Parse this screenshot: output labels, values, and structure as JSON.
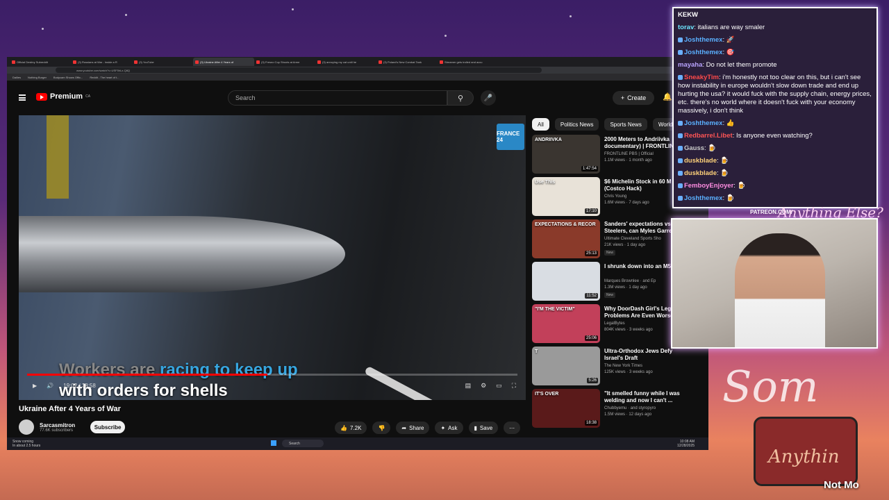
{
  "browser": {
    "tabs": [
      {
        "label": "Official Destiny Subreddit",
        "active": false
      },
      {
        "label": "(3) Russians at War - Inside a R",
        "active": false
      },
      {
        "label": "(3) YouTube",
        "active": false
      },
      {
        "label": "(3) Ukraine After 4 Years of",
        "active": true
      },
      {
        "label": "(3) Fresno Cop Shoots at Arme",
        "active": false
      },
      {
        "label": "(3) annoying my cat until he",
        "active": false
      },
      {
        "label": "(3) Poland's New Combat Tank",
        "active": false
      },
      {
        "label": "Streamer gets trolled and accu",
        "active": false
      }
    ],
    "url": "www.youtube.com/watch?v=USF5hLz-Q8Q",
    "bookmarks": [
      "Dailies",
      "Nothing Burger",
      "Bodycam Shows Offic...",
      "Reddit - The heart of t..."
    ]
  },
  "youtube": {
    "logo": "Premium",
    "logo_region": "CA",
    "search_placeholder": "Search",
    "create_label": "Create",
    "player": {
      "subtitle_dim": "Workers are",
      "subtitle_hl1": "racing to",
      "subtitle_hl2": "keep up",
      "subtitle_line2": "with orders for shells",
      "time": "19:02 / 38:58",
      "progress_fraction": 0.49,
      "channel_logo": "FRANCE 24"
    },
    "video": {
      "title": "Ukraine After 4 Years of War",
      "channel": "Sarcasmitron",
      "subscribers": "77.6K subscribers",
      "subscribe_label": "Subscribe",
      "likes": "7.2K",
      "share_label": "Share",
      "ask_label": "Ask",
      "save_label": "Save"
    },
    "chips": [
      "All",
      "Politics News",
      "Sports News",
      "World N"
    ],
    "recommendations": [
      {
        "title": "2000 Meters to Andriivka documentary) | FRONTLIN",
        "channel": "FRONTLINE PBS | Official",
        "meta": "1.1M views · 1 month ago",
        "duration": "1:47:54",
        "badge": "",
        "thumb_label": "ANDRIIVKA",
        "thumb_color": "#3a3530"
      },
      {
        "title": "$6 Michelin Stock in 60 M (Costco Hack)",
        "channel": "Chris Young",
        "meta": "1.6M views · 7 days ago",
        "duration": "17:10",
        "badge": "",
        "thumb_label": "Use This",
        "thumb_color": "#e8e2d8"
      },
      {
        "title": "Sanders' expectations vs Steelers, can Myles Garre",
        "channel": "Ultimate Cleveland Sports Sho",
        "meta": "21K views · 1 day ago",
        "duration": "25:13",
        "badge": "New",
        "thumb_label": "EXPECTATIONS & RECOR",
        "thumb_color": "#8a3a2a"
      },
      {
        "title": "I shrunk down into an M5",
        "channel": "Marques Brownlee · and Ep",
        "meta": "1.3M views · 1 day ago",
        "duration": "11:52",
        "badge": "New",
        "thumb_label": "",
        "thumb_color": "#d9dde3"
      },
      {
        "title": "Why DoorDash Girl's Lega Problems Are Even Worse",
        "channel": "LegalBytes",
        "meta": "804K views · 3 weeks ago",
        "duration": "25:06",
        "badge": "",
        "thumb_label": "\"I'M THE VICTIM\"",
        "thumb_color": "#c2405a"
      },
      {
        "title": "Ultra-Orthodox Jews Defy Israel's Draft",
        "channel": "The New York Times",
        "meta": "125K views · 3 weeks ago",
        "duration": "5:26",
        "badge": "",
        "thumb_label": "T",
        "thumb_color": "#9a9a9a"
      },
      {
        "title": "\"It smelled funny while I was welding and now I can't ...",
        "channel": "Chubbyemu · and styropyro",
        "meta": "1.5M views · 12 days ago",
        "duration": "18:38",
        "badge": "",
        "thumb_label": "IT'S OVER",
        "thumb_color": "#5a1a1a"
      }
    ]
  },
  "taskbar": {
    "weather_line1": "Snow coming",
    "weather_line2": "In about 2.5 hours",
    "search_label": "Search",
    "time": "10:08 AM",
    "date": "12/28/2025"
  },
  "chat": {
    "title": "KEKW",
    "messages": [
      {
        "user": "torav",
        "color": "#6ee7ff",
        "text": "italians are way smaler",
        "badge": false
      },
      {
        "user": "Joshthemex",
        "color": "#5ab0ff",
        "text": "🚀",
        "badge": true
      },
      {
        "user": "Joshthemex",
        "color": "#5ab0ff",
        "text": "🎯",
        "badge": true
      },
      {
        "user": "mayaha",
        "color": "#b9a4ff",
        "text": "Do not let them promote",
        "badge": false
      },
      {
        "user": "SneakyTim",
        "color": "#ff4a4a",
        "text": "i'm honestly not too clear on this, but i can't see how instability in europe wouldn't slow down trade and end up hurting the usa? it would fuck with the supply chain, energy prices, etc. there's no world where it doesn't fuck with your economy massively, i don't think",
        "badge": true
      },
      {
        "user": "Joshthemex",
        "color": "#5ab0ff",
        "text": "👍",
        "badge": true
      },
      {
        "user": "Redbarrel.Libet",
        "color": "#ff5555",
        "text": "Is anyone even watching?",
        "badge": true
      },
      {
        "user": "Gauss",
        "color": "#c9c9c9",
        "text": "🍺",
        "badge": true
      },
      {
        "user": "duskblade",
        "color": "#ffd27a",
        "text": "🍺",
        "badge": true
      },
      {
        "user": "duskblade",
        "color": "#ffd27a",
        "text": "🍺",
        "badge": true
      },
      {
        "user": "FemboyEnjoyer",
        "color": "#ff8de1",
        "text": "🍺",
        "badge": true
      },
      {
        "user": "Joshthemex",
        "color": "#5ab0ff",
        "text": "🍺",
        "badge": true
      }
    ]
  },
  "overlay": {
    "patreon": "PATREON.COM/",
    "signature": "Anything Else?",
    "big_text": "Som",
    "hat_text": "Anythin",
    "bottom_text": "Not Mo"
  }
}
